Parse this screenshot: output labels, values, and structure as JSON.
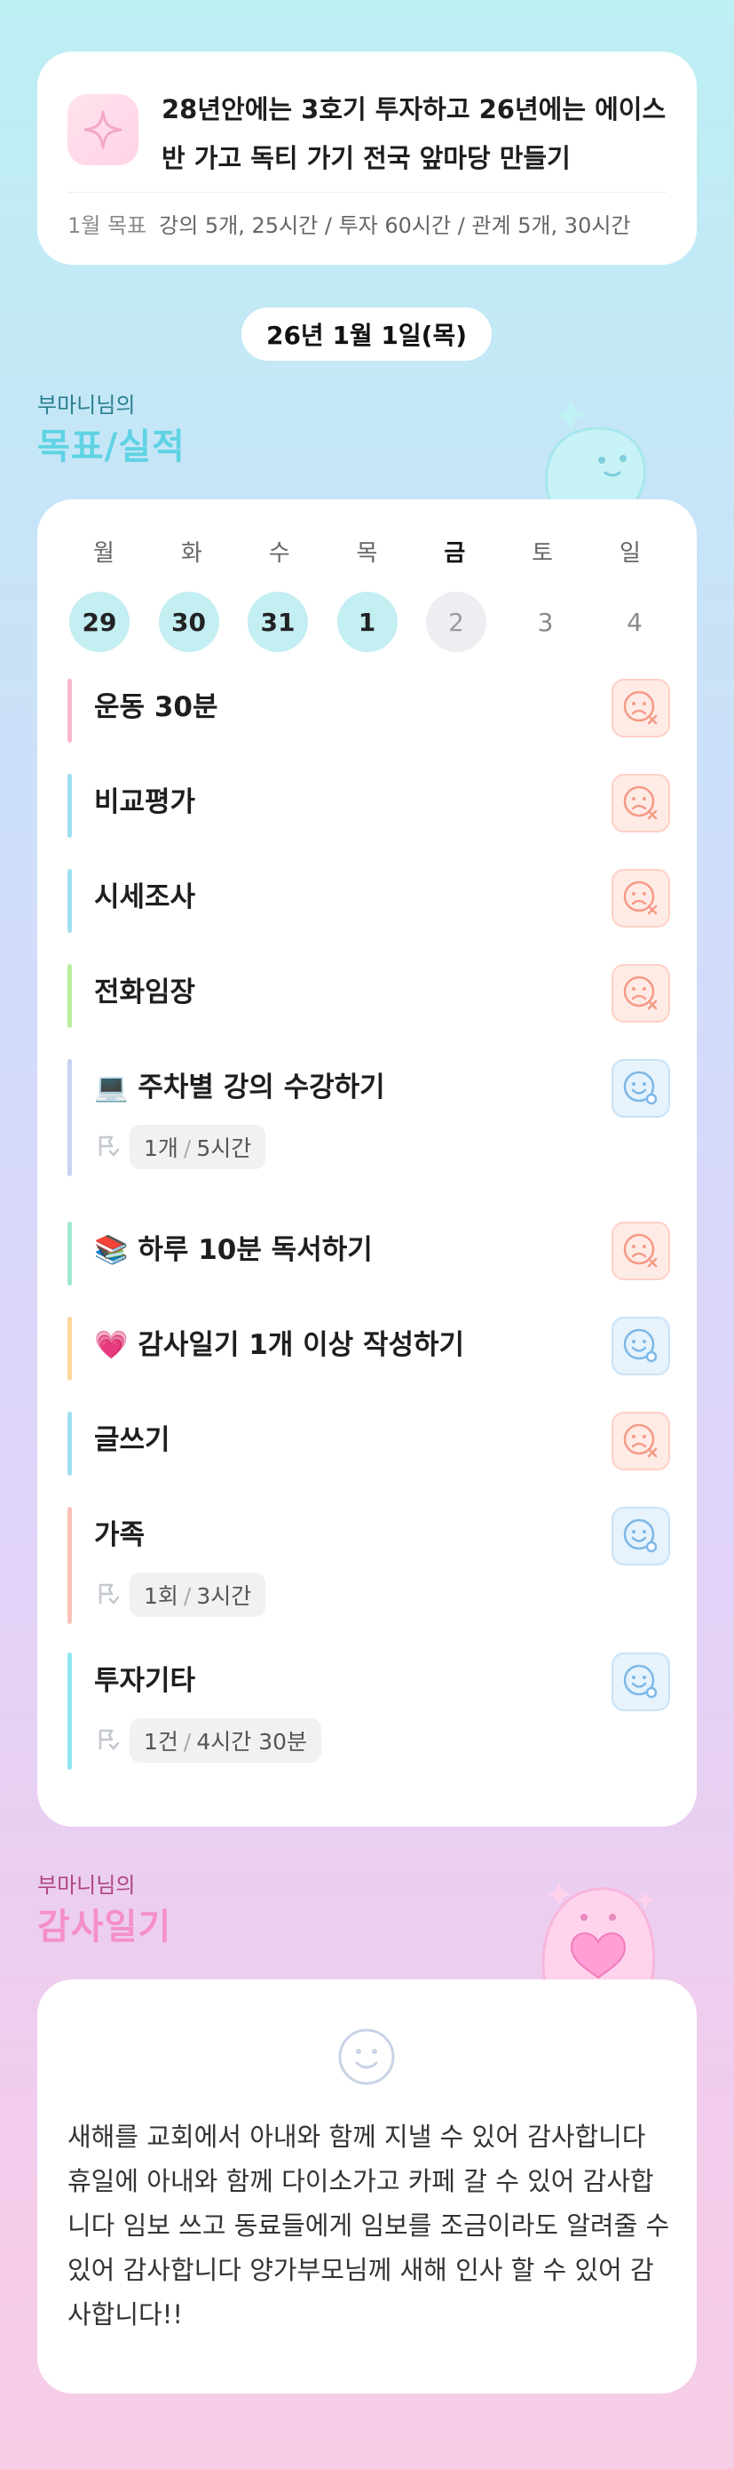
{
  "goal": {
    "title": "28년안에는 3호기 투자하고 26년에는 에이스반 가고 독티 가기 전국 앞마당 만들기",
    "sub_label": "1월 목표",
    "sub_text": "강의 5개, 25시간 / 투자 60시간 / 관계 5개, 30시간"
  },
  "date": "26년 1월 1일(목)",
  "performance": {
    "owner": "부마니님의",
    "title": "목표/실적",
    "weekdays": [
      "월",
      "화",
      "수",
      "목",
      "금",
      "토",
      "일"
    ],
    "dates": [
      "29",
      "30",
      "31",
      "1",
      "2",
      "3",
      "4"
    ],
    "tasks": [
      {
        "name": "운동 30분",
        "bar": "#f7b6cf",
        "status": "fail"
      },
      {
        "name": "비교평가",
        "bar": "#9fdff0",
        "status": "fail"
      },
      {
        "name": "시세조사",
        "bar": "#9fdff0",
        "status": "fail"
      },
      {
        "name": "전화임장",
        "bar": "#b9ee9c",
        "status": "fail"
      },
      {
        "name": "💻 주차별 강의 수강하기",
        "bar": "#c9d3f2",
        "status": "ok",
        "record": {
          "count": "1개",
          "time": "5시간"
        }
      },
      {
        "name": "📚 하루 10분 독서하기",
        "bar": "#9ee8d2",
        "status": "fail"
      },
      {
        "name": "💗 감사일기 1개 이상 작성하기",
        "bar": "#ffd79c",
        "status": "ok"
      },
      {
        "name": "글쓰기",
        "bar": "#9fdff0",
        "status": "fail"
      },
      {
        "name": "가족",
        "bar": "#f9c3b8",
        "status": "ok",
        "record": {
          "count": "1회",
          "time": "3시간"
        }
      },
      {
        "name": "투자기타",
        "bar": "#8fe6ee",
        "status": "ok",
        "record": {
          "count": "1건",
          "time": "4시간 30분"
        }
      }
    ]
  },
  "diary": {
    "owner": "부마니님의",
    "title": "감사일기",
    "text": "새해를 교회에서 아내와 함께 지낼 수 있어 감사합니다 휴일에 아내와 함께 다이소가고 카페 갈 수 있어 감사합니다 임보 쓰고 동료들에게 임보를 조금이라도 알려줄 수 있어 감사합니다 양가부모님께 새해 인사 할 수 있어 감사합니다!!"
  },
  "colors": {
    "perf_title": "#5fd3e3",
    "diary_title": "#f58fc7",
    "owner_perf": "#2a7f8e",
    "owner_diary": "#b0467e"
  },
  "icons": {
    "goal": "sparkle-icon",
    "fail": "sad-face-icon",
    "ok": "smile-face-icon",
    "record": "flag-icon",
    "diary": "smile-icon"
  }
}
